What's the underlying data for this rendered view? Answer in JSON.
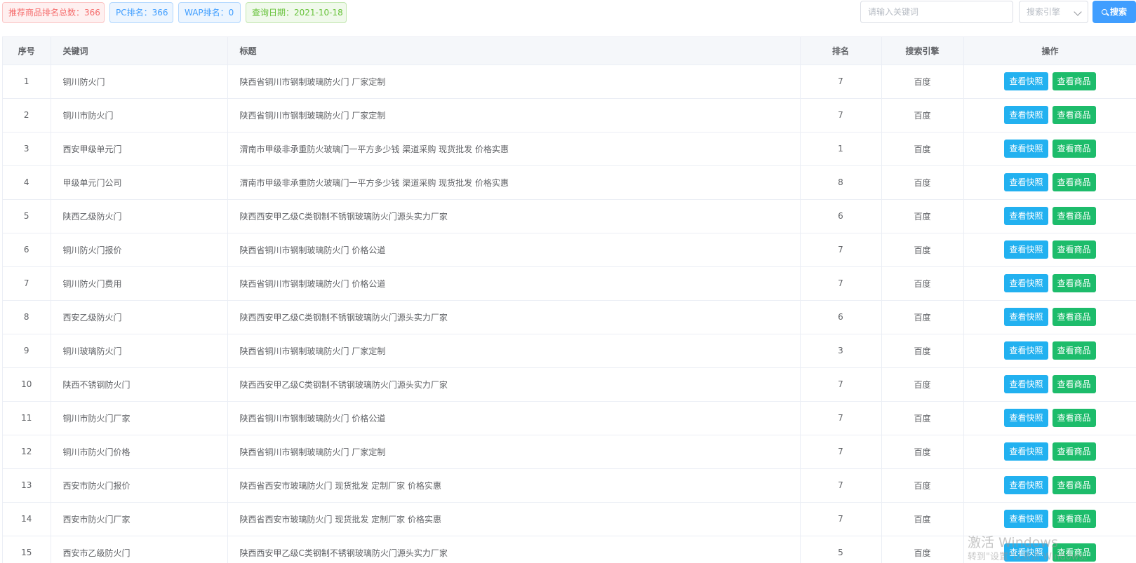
{
  "summary": {
    "total_label": "推荐商品排名总数：366",
    "pc_label": "PC排名：366",
    "wap_label": "WAP排名：0",
    "date_label": "查询日期：2021-10-18"
  },
  "search": {
    "placeholder": "请输入关键词",
    "engine_placeholder": "搜索引擎",
    "button_label": "搜索"
  },
  "table": {
    "headers": [
      "序号",
      "关键词",
      "标题",
      "排名",
      "搜索引擎",
      "操作"
    ],
    "snapshot_label": "查看快照",
    "goods_label": "查看商品",
    "rows": [
      {
        "no": "1",
        "keyword": "铜川防火门",
        "title": "陕西省铜川市钢制玻璃防火门 厂家定制",
        "rank": "7",
        "engine": "百度"
      },
      {
        "no": "2",
        "keyword": "铜川市防火门",
        "title": "陕西省铜川市钢制玻璃防火门 厂家定制",
        "rank": "7",
        "engine": "百度"
      },
      {
        "no": "3",
        "keyword": "西安甲级单元门",
        "title": "渭南市甲级非承重防火玻璃门一平方多少钱 渠道采购 现货批发 价格实惠",
        "rank": "1",
        "engine": "百度"
      },
      {
        "no": "4",
        "keyword": "甲级单元门公司",
        "title": "渭南市甲级非承重防火玻璃门一平方多少钱 渠道采购 现货批发 价格实惠",
        "rank": "8",
        "engine": "百度"
      },
      {
        "no": "5",
        "keyword": "陕西乙级防火门",
        "title": "陕西西安甲乙级C类钢制不锈钢玻璃防火门源头实力厂家",
        "rank": "6",
        "engine": "百度"
      },
      {
        "no": "6",
        "keyword": "铜川防火门报价",
        "title": "陕西省铜川市钢制玻璃防火门 价格公道",
        "rank": "7",
        "engine": "百度"
      },
      {
        "no": "7",
        "keyword": "铜川防火门费用",
        "title": "陕西省铜川市钢制玻璃防火门 价格公道",
        "rank": "7",
        "engine": "百度"
      },
      {
        "no": "8",
        "keyword": "西安乙级防火门",
        "title": "陕西西安甲乙级C类钢制不锈钢玻璃防火门源头实力厂家",
        "rank": "6",
        "engine": "百度"
      },
      {
        "no": "9",
        "keyword": "铜川玻璃防火门",
        "title": "陕西省铜川市钢制玻璃防火门 厂家定制",
        "rank": "3",
        "engine": "百度"
      },
      {
        "no": "10",
        "keyword": "陕西不锈钢防火门",
        "title": "陕西西安甲乙级C类钢制不锈钢玻璃防火门源头实力厂家",
        "rank": "7",
        "engine": "百度"
      },
      {
        "no": "11",
        "keyword": "铜川市防火门厂家",
        "title": "陕西省铜川市钢制玻璃防火门 价格公道",
        "rank": "7",
        "engine": "百度"
      },
      {
        "no": "12",
        "keyword": "铜川市防火门价格",
        "title": "陕西省铜川市钢制玻璃防火门 厂家定制",
        "rank": "7",
        "engine": "百度"
      },
      {
        "no": "13",
        "keyword": "西安市防火门报价",
        "title": "陕西省西安市玻璃防火门 现货批发 定制厂家 价格实惠",
        "rank": "7",
        "engine": "百度"
      },
      {
        "no": "14",
        "keyword": "西安市防火门厂家",
        "title": "陕西省西安市玻璃防火门 现货批发 定制厂家 价格实惠",
        "rank": "7",
        "engine": "百度"
      },
      {
        "no": "15",
        "keyword": "西安市乙级防火门",
        "title": "陕西西安甲乙级C类钢制不锈钢玻璃防火门源头实力厂家",
        "rank": "5",
        "engine": "百度"
      }
    ]
  },
  "watermark": {
    "line1": "激活 Windows",
    "line2": "转到\"设置\"以激活 Windows。"
  },
  "colors": {
    "primary": "#409eff",
    "snapshot_button": "#22b1f0",
    "goods_button": "#1dbc6b",
    "danger_tag": "#f56c6c",
    "success_tag": "#67c23a"
  }
}
